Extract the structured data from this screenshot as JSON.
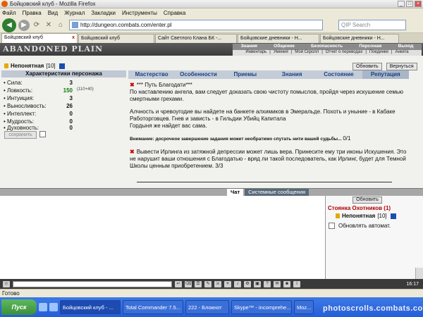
{
  "window": {
    "title": "Бойцовский клуб - Mozilla Firefox"
  },
  "menu": [
    "Файл",
    "Правка",
    "Вид",
    "Журнал",
    "Закладки",
    "Инструменты",
    "Справка"
  ],
  "nav": {
    "url": "http://dungeon.combats.com/enter.pl",
    "search_placeholder": "QIP Search"
  },
  "tabs": [
    {
      "label": "Бойцовский клуб",
      "active": true
    },
    {
      "label": "Бойцовский клуб",
      "active": false
    },
    {
      "label": "Сайт Светлого Клана БК -...",
      "active": false
    },
    {
      "label": "Бойцовские дневники - Н...",
      "active": false
    },
    {
      "label": "Бойцовские дневники - Н...",
      "active": false
    }
  ],
  "game": {
    "logo": "ABANDONED PLAIN",
    "topnav_primary": [
      "Знания",
      "Общение",
      "Безопасность",
      "Персонаж",
      "Выход"
    ],
    "topnav_secondary": [
      "Инвентарь",
      "Умения",
      "Мой Скролл",
      "Отчет о переводах",
      "Поединки",
      "Анкета"
    ],
    "character": {
      "name": "Непонятная",
      "level": "[10]"
    },
    "buttons": {
      "refresh": "Обновить",
      "return": "Вернуться",
      "save": "сохранить"
    },
    "stats_header": "Характеристики персонажа",
    "stats": [
      {
        "label": "• Сила:",
        "value": "3",
        "extra": ""
      },
      {
        "label": "• Ловкость:",
        "value": "150",
        "extra": "(110+40)"
      },
      {
        "label": "• Интуиция:",
        "value": "3",
        "extra": ""
      },
      {
        "label": "• Выносливость:",
        "value": "26",
        "extra": ""
      },
      {
        "label": "• Интеллект:",
        "value": "0",
        "extra": ""
      },
      {
        "label": "• Мудрость:",
        "value": "0",
        "extra": ""
      },
      {
        "label": "• Духовность:",
        "value": "0",
        "extra": ""
      }
    ],
    "section_tabs": [
      "Мастерство",
      "Особенности",
      "Приемы",
      "Знания",
      "Состояние",
      "Репутация"
    ],
    "quest1": {
      "title": "*** Путь Благодати***",
      "body": "По наставлению ангела, вам следует доказать свою чистоту помыслов, пройдя через искушение семью смертными грехами.",
      "body2": "Алчность и чревоугодие вы найдете на банкете алхимиков в Эмеральде. Похоть и уныние - в Кабаке Работорговцев. Гнев и зависть - в Гильдии Убийц Капитала",
      "body3": "Гордыня же найдет вас сама.",
      "warning": "Внимание: досрочное завершение задания может необратимо спутать нити вашей судьбы...",
      "progress": "0/1"
    },
    "quest2": {
      "body": "Вывести Ирлинга из затяжной депрессии может лишь вера. Принесите ему три иконы Искушения. Это не нарушит ваши отношения с Благодатью - вряд ли такой последователь, как Ирлинг, будет для Темной Школы ценным приобретением. 3/3"
    },
    "chat_tabs": [
      "Чат",
      "Системные сообщения"
    ],
    "room": {
      "title": "Стоянка Охотников (1)",
      "member": "Непонятная",
      "member_level": "[10]",
      "auto_refresh": "Обновлять автомат."
    },
    "clock": "16:17"
  },
  "statusbar": "Готово",
  "taskbar": {
    "start": "Пуск",
    "tasks": [
      "Бойцовский клуб - ...",
      "Total Commander 7.5...",
      "222 - Блокнот",
      "Skype™ - incomprehe...",
      "Moz..."
    ]
  },
  "watermark": "photoscrolls.combats.com"
}
